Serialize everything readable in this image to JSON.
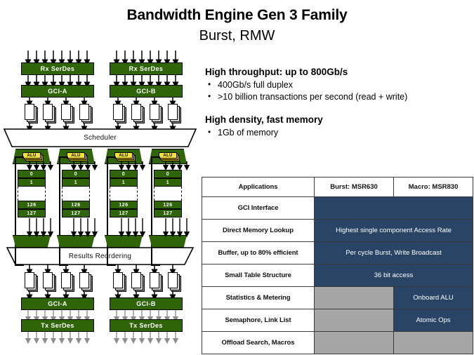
{
  "slide": {
    "title": "Bandwidth Engine Gen 3 Family",
    "subtitle": "Burst, RMW"
  },
  "content": {
    "section1": {
      "heading": "High throughput: up to 800Gb/s",
      "bullets": [
        "400Gb/s full duplex",
        ">10 billion transactions per second (read + write)"
      ]
    },
    "section2": {
      "heading": "High density, fast memory",
      "bullets": [
        "1Gb of memory"
      ]
    }
  },
  "table": {
    "headers": [
      "Applications",
      "Burst: MSR630",
      "Macro: MSR830"
    ],
    "rows": [
      {
        "label": "GCI Interface",
        "burst": "",
        "macro": "",
        "merged": true,
        "merged_text": "",
        "burst_style": "navy",
        "macro_style": "navy"
      },
      {
        "label": "Direct Memory Lookup",
        "merged": true,
        "merged_text": "Highest single component Access Rate",
        "style": "navy"
      },
      {
        "label": "Buffer, up to 80% efficient",
        "merged": true,
        "merged_text": "Per cycle Burst, Write Broadcast",
        "style": "navy"
      },
      {
        "label": "Small Table Structure",
        "merged": true,
        "merged_text": "36 bit access",
        "style": "navy"
      },
      {
        "label": "Statistics & Metering",
        "merged": false,
        "burst": "",
        "macro": "Onboard ALU",
        "burst_style": "gray",
        "macro_style": "navy"
      },
      {
        "label": "Semaphore, Link List",
        "merged": false,
        "burst": "",
        "macro": "Atomic Ops",
        "burst_style": "gray",
        "macro_style": "navy"
      },
      {
        "label": "Offload Search, Macros",
        "merged": false,
        "burst": "",
        "macro": "",
        "burst_style": "gray",
        "macro_style": "gray"
      }
    ]
  },
  "diagram": {
    "rx_serdes_a": "Rx SerDes",
    "rx_serdes_b": "Rx SerDes",
    "gci_a_top": "GCI-A",
    "gci_b_top": "GCI-B",
    "scheduler": "Scheduler",
    "results_reordering": "Results Reordering",
    "gci_a_bottom": "GCI-A",
    "gci_b_bottom": "GCI-B",
    "tx_serdes_a": "Tx SerDes",
    "tx_serdes_b": "Tx SerDes",
    "alu_label": "ALU",
    "mem_rows": [
      "0",
      "1",
      "126",
      "127"
    ]
  },
  "colors": {
    "green": "#2f6409",
    "navy": "#2a4466",
    "gray": "#a6a6a6",
    "yellow": "#f5e13c"
  }
}
